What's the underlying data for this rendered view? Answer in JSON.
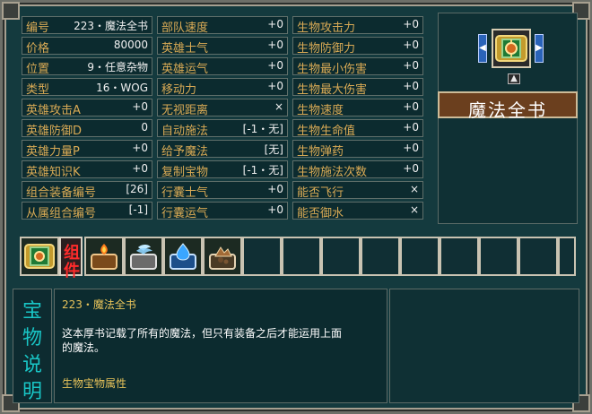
{
  "artifact": {
    "number_label": "编号",
    "number_value": "223・魔法全书",
    "price_label": "价格",
    "price_value": "80000",
    "slot_label": "位置",
    "slot_value": "9・任意杂物",
    "type_label": "类型",
    "type_value": "16・WOG",
    "hero_attack_label": "英雄攻击A",
    "hero_attack_value": "+0",
    "hero_defense_label": "英雄防御D",
    "hero_defense_value": "0",
    "hero_power_label": "英雄力量P",
    "hero_power_value": "+0",
    "hero_knowledge_label": "英雄知识K",
    "hero_knowledge_value": "+0",
    "combo_id_label": "组合装备编号",
    "combo_id_value": "[26]",
    "subcombo_id_label": "从属组合编号",
    "subcombo_id_value": "[-1]"
  },
  "stats_col2": [
    {
      "label": "部队速度",
      "value": "+0"
    },
    {
      "label": "英雄士气",
      "value": "+0"
    },
    {
      "label": "英雄运气",
      "value": "+0"
    },
    {
      "label": "移动力",
      "value": "+0"
    },
    {
      "label": "无视距离",
      "value": "×"
    },
    {
      "label": "自动施法",
      "value": "[-1・无]"
    },
    {
      "label": "给予魔法",
      "value": "[无]"
    },
    {
      "label": "复制宝物",
      "value": "[-1・无]"
    },
    {
      "label": "行囊士气",
      "value": "+0"
    },
    {
      "label": "行囊运气",
      "value": "+0"
    }
  ],
  "stats_col3": [
    {
      "label": "生物攻击力",
      "value": "+0"
    },
    {
      "label": "生物防御力",
      "value": "+0"
    },
    {
      "label": "生物最小伤害",
      "value": "+0"
    },
    {
      "label": "生物最大伤害",
      "value": "+0"
    },
    {
      "label": "生物速度",
      "value": "+0"
    },
    {
      "label": "生物生命值",
      "value": "+0"
    },
    {
      "label": "生物弹药",
      "value": "+0"
    },
    {
      "label": "生物施法次数",
      "value": "+0"
    },
    {
      "label": "能否飞行",
      "value": "×"
    },
    {
      "label": "能否御水",
      "value": "×"
    }
  ],
  "right_panel": {
    "title": "魔法全书",
    "prev_arrow": "◀",
    "next_arrow": "▶",
    "up_caret": "▲",
    "selected_icon_name": "book-of-magic-icon"
  },
  "components": {
    "label_chars": [
      "组",
      "件"
    ],
    "items": [
      {
        "name": "book-of-magic-icon"
      },
      {
        "name": "fire-magic-book-icon"
      },
      {
        "name": "air-magic-book-icon"
      },
      {
        "name": "water-magic-book-icon"
      },
      {
        "name": "earth-magic-book-icon"
      }
    ],
    "empty_slots": 9
  },
  "description": {
    "side_title_chars": [
      "宝",
      "物",
      "说",
      "明"
    ],
    "line1": "223・魔法全书",
    "line2": "这本厚书记载了所有的魔法，但只有装备之后才能运用上面",
    "line3": "的魔法。",
    "line4": "生物宝物属性"
  }
}
